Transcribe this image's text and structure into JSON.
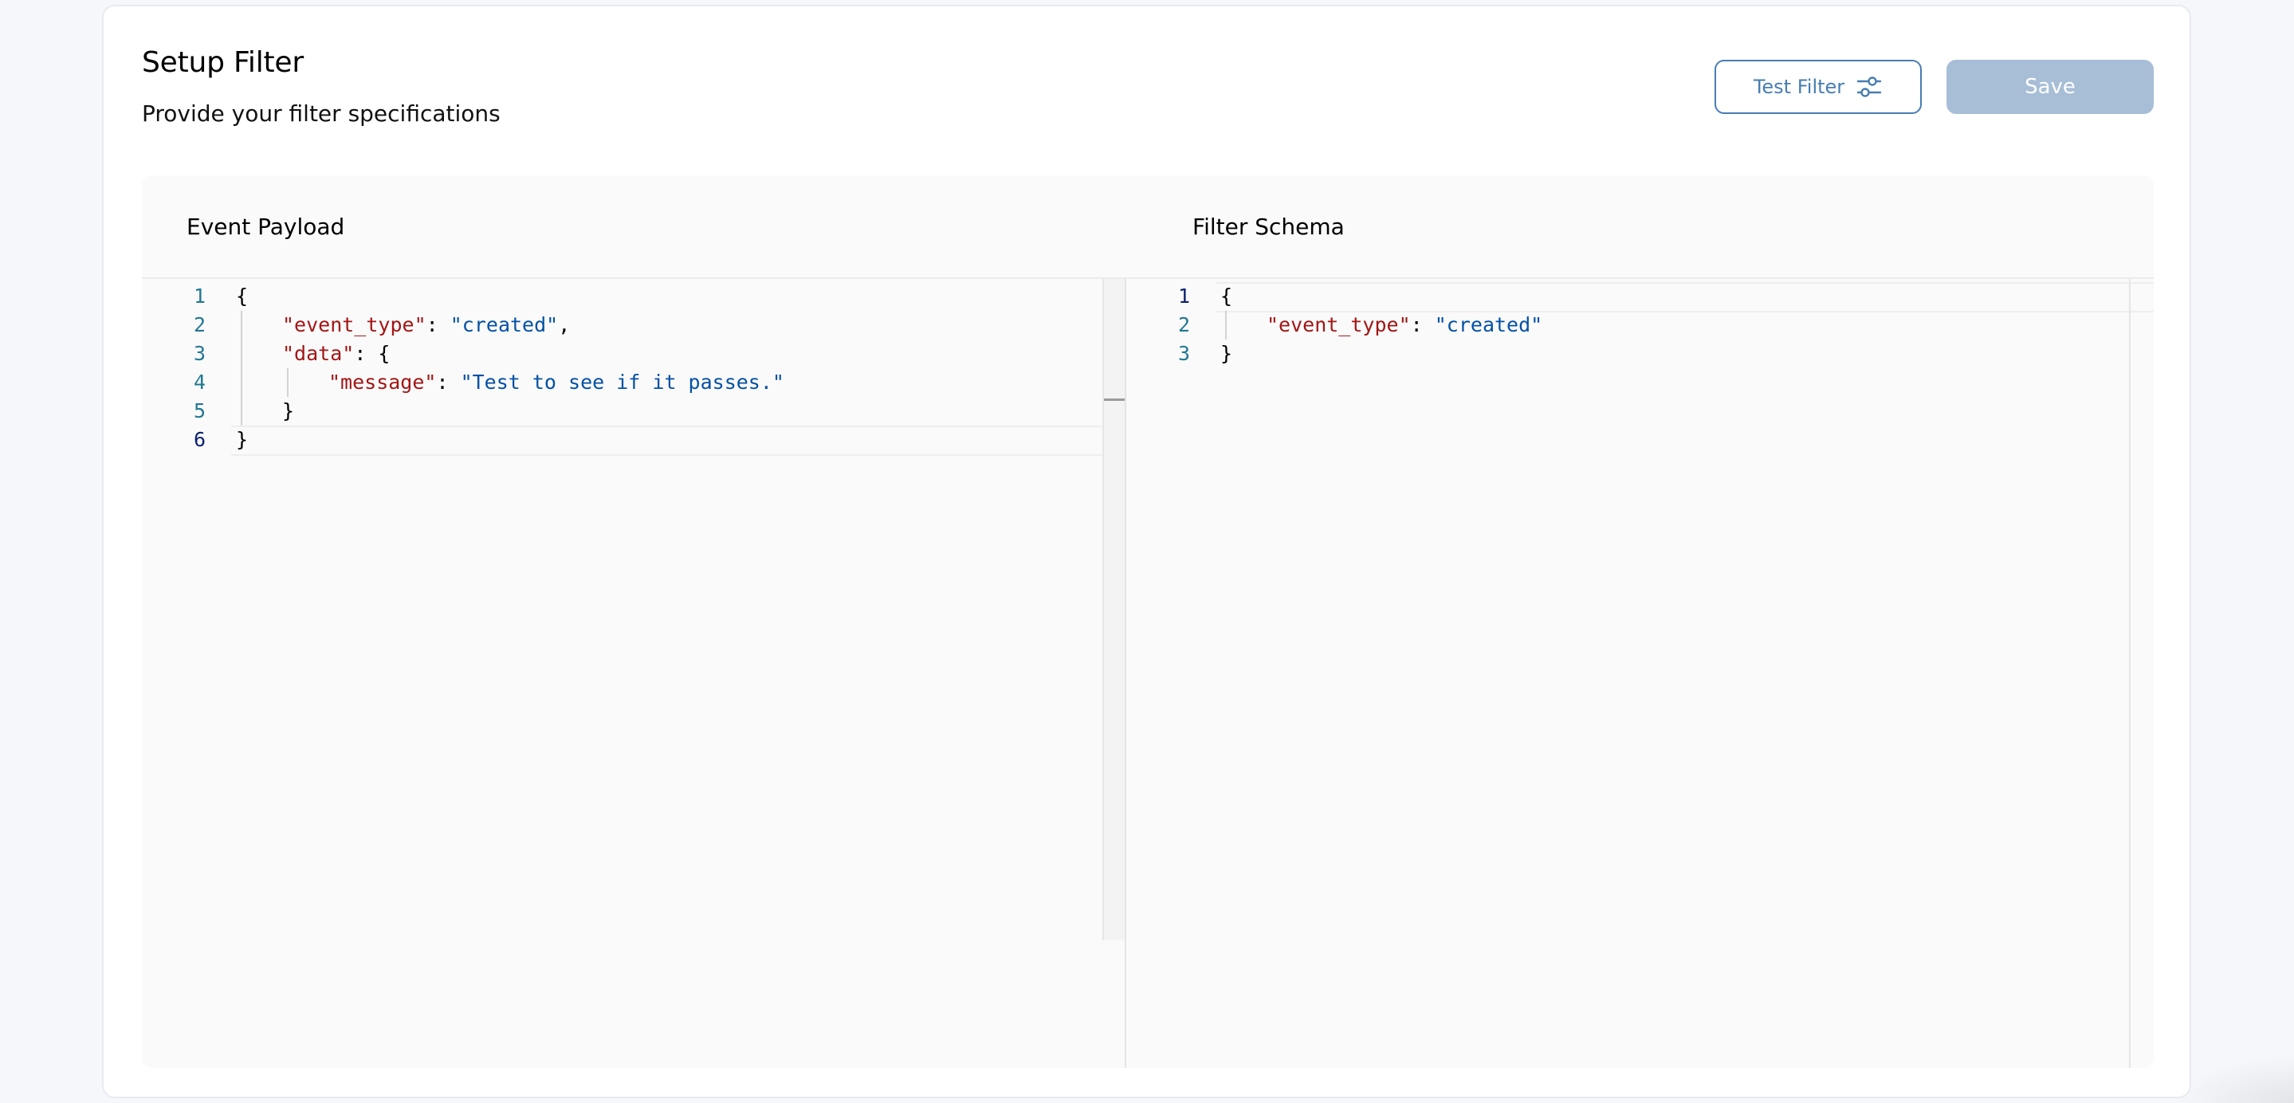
{
  "header": {
    "title": "Setup Filter",
    "subtitle": "Provide your filter specifications"
  },
  "actions": {
    "test_label": "Test Filter",
    "test_icon": "sliders-icon",
    "save_label": "Save",
    "save_disabled": true
  },
  "colors": {
    "accent": "#477db3",
    "save_disabled_bg": "#a7bed6",
    "json_key": "#a31515",
    "json_string": "#0451a5",
    "line_number": "#237893"
  },
  "event_payload": {
    "label": "Event Payload",
    "lines": [
      {
        "n": "1",
        "indent": 0,
        "tokens": [
          {
            "t": "p",
            "v": "{"
          }
        ]
      },
      {
        "n": "2",
        "indent": 1,
        "tokens": [
          {
            "t": "k",
            "v": "\"event_type\""
          },
          {
            "t": "p",
            "v": ": "
          },
          {
            "t": "s",
            "v": "\"created\""
          },
          {
            "t": "p",
            "v": ","
          }
        ]
      },
      {
        "n": "3",
        "indent": 1,
        "tokens": [
          {
            "t": "k",
            "v": "\"data\""
          },
          {
            "t": "p",
            "v": ": {"
          }
        ]
      },
      {
        "n": "4",
        "indent": 2,
        "tokens": [
          {
            "t": "k",
            "v": "\"message\""
          },
          {
            "t": "p",
            "v": ": "
          },
          {
            "t": "s",
            "v": "\"Test to see if it passes.\""
          }
        ]
      },
      {
        "n": "5",
        "indent": 1,
        "tokens": [
          {
            "t": "p",
            "v": "}"
          }
        ]
      },
      {
        "n": "6",
        "indent": 0,
        "tokens": [
          {
            "t": "p",
            "v": "}"
          }
        ]
      }
    ],
    "active_line": 6
  },
  "filter_schema": {
    "label": "Filter Schema",
    "lines": [
      {
        "n": "1",
        "indent": 0,
        "tokens": [
          {
            "t": "p",
            "v": "{"
          }
        ]
      },
      {
        "n": "2",
        "indent": 1,
        "tokens": [
          {
            "t": "k",
            "v": "\"event_type\""
          },
          {
            "t": "p",
            "v": ": "
          },
          {
            "t": "s",
            "v": "\"created\""
          }
        ]
      },
      {
        "n": "3",
        "indent": 0,
        "tokens": [
          {
            "t": "p",
            "v": "}"
          }
        ]
      }
    ],
    "active_line": 1
  }
}
